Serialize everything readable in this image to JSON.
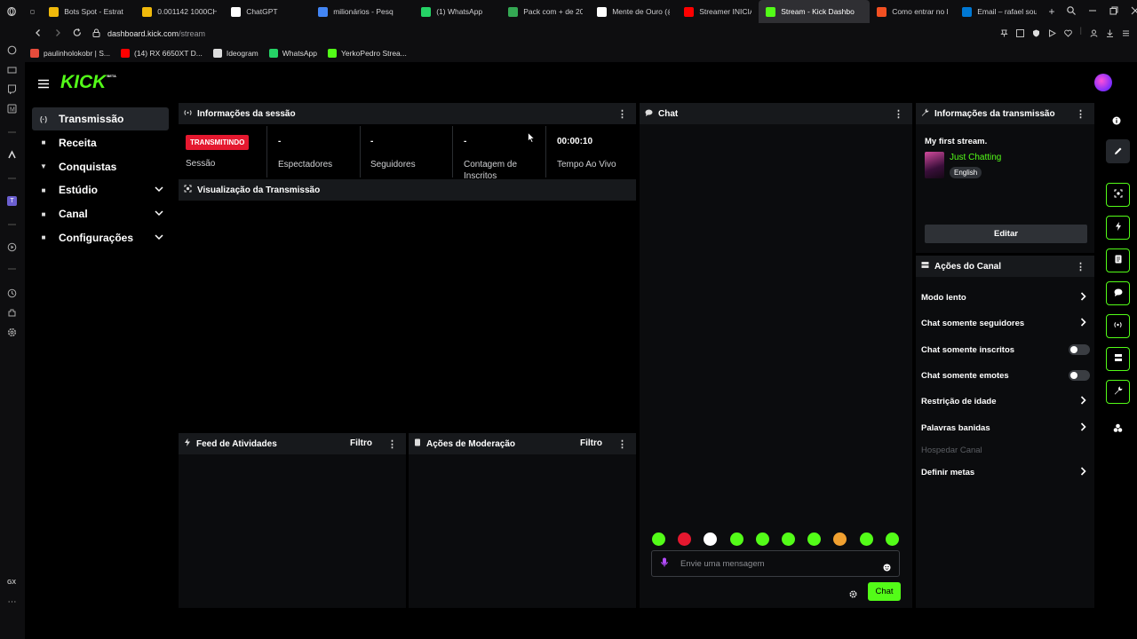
{
  "browser": {
    "tabs": [
      {
        "label": "Bots Spot - Estrat",
        "icon": "binance-icon",
        "color": "#f0b90b"
      },
      {
        "label": "0.001142 1000CH",
        "icon": "binance-icon",
        "color": "#f0b90b"
      },
      {
        "label": "ChatGPT",
        "icon": "chatgpt-icon",
        "color": "#ffffff"
      },
      {
        "label": "milionários - Pesq",
        "icon": "google-icon",
        "color": "#4285f4"
      },
      {
        "label": "(1) WhatsApp",
        "icon": "whatsapp-icon",
        "color": "#25d366"
      },
      {
        "label": "Pack com + de 20",
        "icon": "drive-icon",
        "color": "#34a853"
      },
      {
        "label": "Mente de Ouro (@",
        "icon": "tiktok-icon",
        "color": "#ffffff"
      },
      {
        "label": "Streamer INICIAN",
        "icon": "youtube-icon",
        "color": "#ff0000"
      },
      {
        "label": "Stream - Kick Dashbo",
        "icon": "kick-icon",
        "color": "#53fc18",
        "active": true
      },
      {
        "label": "Como entrar no lo",
        "icon": "microsoft-icon",
        "color": "#f25022"
      },
      {
        "label": "Email – rafael sou",
        "icon": "outlook-icon",
        "color": "#0078d4"
      }
    ],
    "url": "dashboard.kick.com/stream",
    "url_host": "dashboard.kick.com",
    "url_path": "/stream",
    "bookmarks": [
      {
        "label": "paulinholokobr | S...",
        "icon": "kick-bookmark-icon",
        "color": "#e74c3c"
      },
      {
        "label": "(14) RX 6650XT D...",
        "icon": "youtube-icon",
        "color": "#ff0000"
      },
      {
        "label": "Ideogram",
        "icon": "ideogram-icon",
        "color": "#dddddd"
      },
      {
        "label": "WhatsApp",
        "icon": "whatsapp-icon",
        "color": "#25d366"
      },
      {
        "label": "YerkoPedro Strea...",
        "icon": "kick-icon",
        "color": "#53fc18"
      }
    ],
    "sidebar_label": "GX"
  },
  "brand": {
    "logo": "KICK",
    "beta": "BETA",
    "accent": "#53fc18",
    "live_red": "#e5182f"
  },
  "nav": {
    "items": [
      {
        "label": "Transmissão",
        "icon": "broadcast-icon",
        "active": true,
        "expandable": false
      },
      {
        "label": "Receita",
        "icon": "revenue-icon",
        "active": false,
        "expandable": false
      },
      {
        "label": "Conquistas",
        "icon": "trophy-icon",
        "active": false,
        "expandable": false
      },
      {
        "label": "Estúdio",
        "icon": "studio-icon",
        "active": false,
        "expandable": true
      },
      {
        "label": "Canal",
        "icon": "channel-icon",
        "active": false,
        "expandable": true
      },
      {
        "label": "Configurações",
        "icon": "gear-icon",
        "active": false,
        "expandable": true
      }
    ]
  },
  "session": {
    "title": "Informações da sessão",
    "status_badge": "TRANSMITINDO",
    "status_label": "Sessão",
    "stats": [
      {
        "value": "-",
        "label": "Espectadores"
      },
      {
        "value": "-",
        "label": "Seguidores"
      },
      {
        "value": "-",
        "label": "Contagem de Inscritos"
      },
      {
        "value": "00:00:10",
        "label": "Tempo Ao Vivo"
      }
    ]
  },
  "preview": {
    "title": "Visualização da Transmissão"
  },
  "activity_feed": {
    "title": "Feed de Atividades",
    "filter": "Filtro"
  },
  "moderation": {
    "title": "Ações de Moderação",
    "filter": "Filtro"
  },
  "chat": {
    "title": "Chat",
    "placeholder": "Envie uma mensagem",
    "send_label": "Chat",
    "emotes": [
      "emote-1",
      "emote-2",
      "emote-3",
      "emote-4",
      "emote-5",
      "emote-6",
      "emote-7",
      "emote-8",
      "emote-9",
      "emote-10"
    ]
  },
  "stream_info": {
    "title": "Informações da transmissão",
    "stream_title": "My first stream.",
    "category": "Just Chatting",
    "language": "English",
    "edit_label": "Editar"
  },
  "channel_actions": {
    "title": "Ações do Canal",
    "items": [
      {
        "label": "Modo lento",
        "kind": "arrow"
      },
      {
        "label": "Chat somente seguidores",
        "kind": "arrow"
      },
      {
        "label": "Chat somente inscritos",
        "kind": "toggle",
        "on": false
      },
      {
        "label": "Chat somente emotes",
        "kind": "toggle",
        "on": false
      },
      {
        "label": "Restrição de idade",
        "kind": "arrow"
      },
      {
        "label": "Palavras banidas",
        "kind": "arrow"
      },
      {
        "label": "Hospedar Canal",
        "kind": "disabled"
      },
      {
        "label": "Definir metas",
        "kind": "arrow"
      }
    ]
  }
}
